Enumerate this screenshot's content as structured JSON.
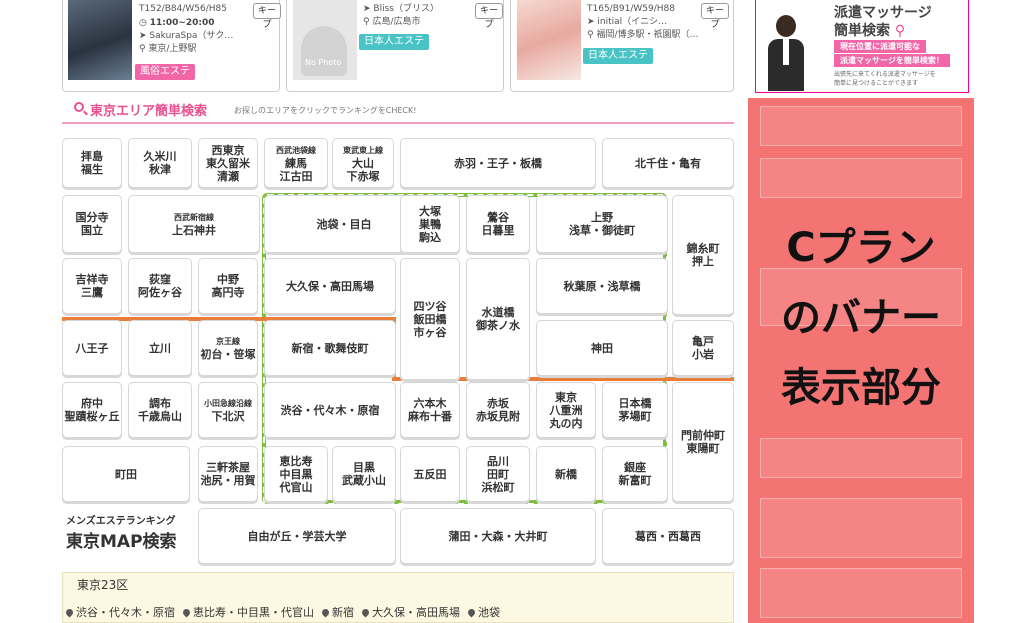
{
  "cards": [
    {
      "name": "card-sakuraspa",
      "lines": [
        "T152/B84/W56/H85",
        "11:00~20:00",
        "SakuraSpa（サク…",
        "東京/上野駅"
      ],
      "keep": "キープ",
      "tag": "風俗エステ",
      "tag_color": "#f266a8"
    },
    {
      "name": "card-bliss",
      "lines": [
        "Bliss（ブリス）",
        "広島/広島市"
      ],
      "keep": "キープ",
      "tag": "日本人エステ",
      "tag_color": "#49c3c5",
      "thumb_text": "No Photo"
    },
    {
      "name": "card-initial",
      "lines": [
        "T165/B91/W59/H88",
        "initial（イニシ…",
        "福岡/博多駅・祇園駅（…"
      ],
      "keep": "キープ",
      "tag": "日本人エステ",
      "tag_color": "#49c3c5"
    }
  ],
  "section": {
    "title": "東京エリア簡単検索",
    "subtitle": "お探しのエリアをクリックでランキングをCHECK!"
  },
  "areas": [
    {
      "l1": "拝島",
      "l2": "福生"
    },
    {
      "l1": "久米川",
      "l2": "秋津"
    },
    {
      "l1": "西東京",
      "l2": "東久留米",
      "l3": "清瀬"
    },
    {
      "sm": "西武池袋線",
      "l1": "練馬",
      "l2": "江古田"
    },
    {
      "sm": "東武東上線",
      "l1": "大山",
      "l2": "下赤塚"
    },
    {
      "l1": "赤羽・王子・板橋"
    },
    {
      "l1": "北千住・亀有"
    },
    {
      "l1": "国分寺",
      "l2": "国立"
    },
    {
      "sm": "西武新宿線",
      "l1": "上石神井"
    },
    {
      "l1": "池袋・目白"
    },
    {
      "l1": "大塚",
      "l2": "巣鴨",
      "l3": "駒込"
    },
    {
      "l1": "鶯谷",
      "l2": "日暮里"
    },
    {
      "l1": "上野",
      "l2": "浅草・御徒町"
    },
    {
      "l1": "錦糸町",
      "l2": "押上"
    },
    {
      "l1": "吉祥寺",
      "l2": "三鷹"
    },
    {
      "l1": "荻窪",
      "l2": "阿佐ヶ谷"
    },
    {
      "l1": "中野",
      "l2": "高円寺"
    },
    {
      "l1": "大久保・高田馬場"
    },
    {
      "l1": "四ツ谷",
      "l2": "飯田橋",
      "l3": "市ヶ谷"
    },
    {
      "l1": "水道橋",
      "l2": "御茶ノ水"
    },
    {
      "l1": "秋葉原・浅草橋"
    },
    {
      "l1": "八王子"
    },
    {
      "l1": "立川"
    },
    {
      "sm": "京王線",
      "l1": "初台・笹塚"
    },
    {
      "l1": "新宿・歌舞伎町"
    },
    {
      "l1": "神田"
    },
    {
      "l1": "亀戸",
      "l2": "小岩"
    },
    {
      "l1": "府中",
      "l2": "聖蹟桜ヶ丘"
    },
    {
      "l1": "調布",
      "l2": "千歳烏山"
    },
    {
      "sm": "小田急線沿線",
      "l1": "下北沢"
    },
    {
      "l1": "渋谷・代々木・原宿"
    },
    {
      "l1": "六本木",
      "l2": "麻布十番"
    },
    {
      "l1": "赤坂",
      "l2": "赤坂見附"
    },
    {
      "l1": "東京",
      "l2": "八重洲",
      "l3": "丸の内"
    },
    {
      "l1": "日本橋",
      "l2": "茅場町"
    },
    {
      "l1": "門前仲町",
      "l2": "東陽町"
    },
    {
      "l1": "町田"
    },
    {
      "l1": "三軒茶屋",
      "l2": "池尻・用賀"
    },
    {
      "l1": "恵比寿",
      "l2": "中目黒",
      "l3": "代官山"
    },
    {
      "l1": "目黒",
      "l2": "武蔵小山"
    },
    {
      "l1": "五反田"
    },
    {
      "l1": "品川",
      "l2": "田町",
      "l3": "浜松町"
    },
    {
      "l1": "新橋"
    },
    {
      "l1": "銀座",
      "l2": "新富町"
    },
    {
      "l1": "自由が丘・学芸大学"
    },
    {
      "l1": "蒲田・大森・大井町"
    },
    {
      "l1": "葛西・西葛西"
    }
  ],
  "brand": {
    "line1": "メンズエステランキング",
    "line2": "東京MAP検索"
  },
  "wards": {
    "title": "東京23区",
    "links": [
      "渋谷・代々木・原宿",
      "恵比寿・中目黒・代官山",
      "新宿",
      "大久保・高田馬場",
      "池袋"
    ]
  },
  "ad_top": {
    "line1": "派遣マッサージ",
    "line2": "簡単検索",
    "line3": "現在位置に派遣可能な",
    "line4": "派遣マッサージを簡単検索！",
    "line5": "出張先に来てくれる派遣マッサージを",
    "line6": "簡単に見つけることができます"
  },
  "banner": {
    "lines": [
      "Cプラン",
      "のバナー",
      "表示部分"
    ],
    "overlay_color": "#f47474"
  },
  "colors": {
    "accent": "#e8508f",
    "line_green": "#7cbf3a",
    "line_orange": "#e87e3a"
  },
  "icons": [
    "clock-icon",
    "location-pin-icon",
    "search-icon"
  ]
}
